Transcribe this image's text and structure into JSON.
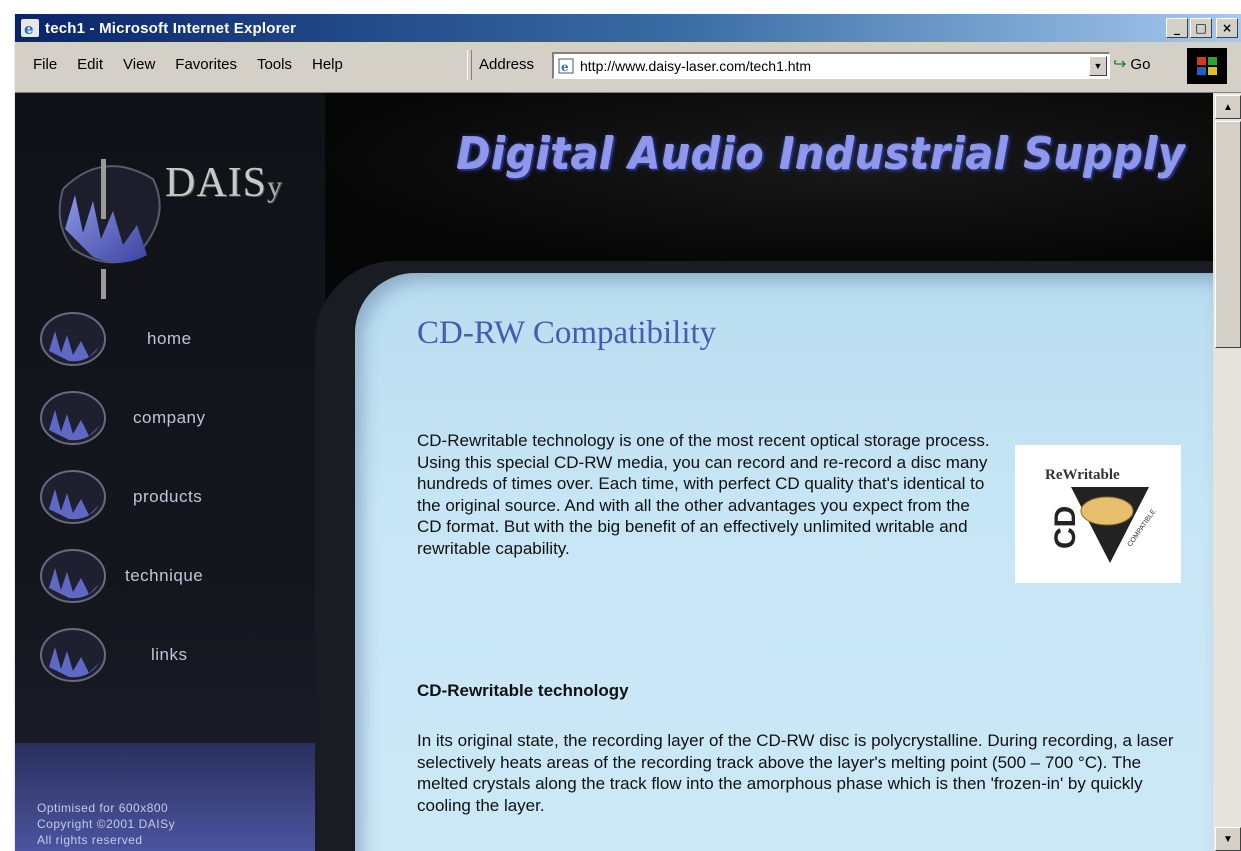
{
  "window": {
    "title": "tech1 - Microsoft Internet Explorer",
    "controls": {
      "minimize": "_",
      "maximize": "□",
      "close": "×"
    }
  },
  "menu": {
    "items": [
      {
        "label": "File"
      },
      {
        "label": "Edit"
      },
      {
        "label": "View"
      },
      {
        "label": "Favorites"
      },
      {
        "label": "Tools"
      },
      {
        "label": "Help"
      }
    ]
  },
  "address": {
    "label": "Address",
    "url": "http://www.daisy-laser.com/tech1.htm",
    "go_label": "Go"
  },
  "site": {
    "logo_text": "DAIS",
    "logo_text_small": "y",
    "banner_title": "Digital Audio Industrial Supply",
    "nav": [
      {
        "label": "home"
      },
      {
        "label": "company"
      },
      {
        "label": "products"
      },
      {
        "label": "technique"
      },
      {
        "label": "links"
      }
    ],
    "footer": [
      "Optimised for 600x800",
      "Copyright ©2001 DAISy",
      "All rights reserved"
    ]
  },
  "content": {
    "title": "CD-RW Compatibility",
    "intro": "CD-Rewritable technology is one of the most recent optical storage process. Using this special CD-RW media, you can record and re-record a disc many hundreds of times over. Each time, with perfect CD quality that's identical to the original source. And with all the other advantages you expect from the CD format. But with the big benefit of an effectively unlimited writable and rewritable capability.",
    "logo": {
      "top_text": "ReWritable",
      "letters": "CD",
      "side_text": "COMPATIBLE"
    },
    "subheading": "CD-Rewritable technology",
    "body": "In its original state, the recording layer of the CD-RW disc is polycrystalline. During recording, a laser selectively heats areas of the recording track above the layer's melting point (500 – 700 °C). The melted crystals along the track flow into the amorphous phase which is then 'frozen-in' by quickly cooling the layer."
  },
  "colors": {
    "title_bar": "#0a246a",
    "banner_text": "#8f98ec",
    "content_bg": "#c7e6f5",
    "page_title": "#4a5ab0"
  }
}
